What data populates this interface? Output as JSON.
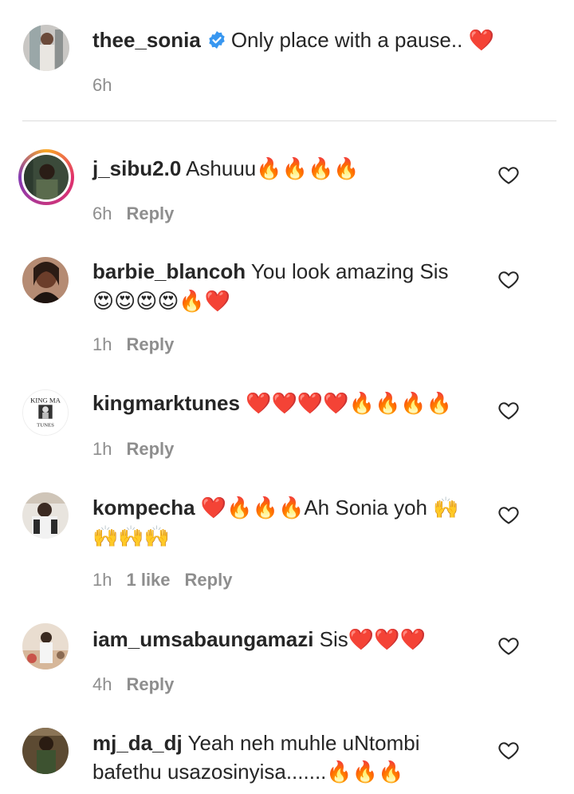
{
  "caption": {
    "username": "thee_sonia",
    "text": "Only place with a pause.. ❤️",
    "time": "6h"
  },
  "comments": [
    {
      "username": "j_sibu2.0",
      "line1": "Ashuuu🔥🔥🔥🔥",
      "line2": "",
      "time": "6h",
      "likes": "",
      "reply": "Reply",
      "has_story_ring": true
    },
    {
      "username": "barbie_blancoh",
      "line1": "You look amazing Sis",
      "line2": "😍😍😍😍🔥❤️",
      "time": "1h",
      "likes": "",
      "reply": "Reply",
      "has_story_ring": false
    },
    {
      "username": "kingmarktunes",
      "line1": "❤️❤️❤️❤️🔥🔥🔥🔥",
      "line2": "",
      "time": "1h",
      "likes": "",
      "reply": "Reply",
      "has_story_ring": false
    },
    {
      "username": "kompecha",
      "line1": "❤️🔥🔥🔥Ah Sonia yoh 🙌",
      "line2": "🙌🙌🙌",
      "time": "1h",
      "likes": "1 like",
      "reply": "Reply",
      "has_story_ring": false
    },
    {
      "username": "iam_umsabaungamazi",
      "line1": "Sis❤️❤️❤️",
      "line2": "",
      "time": "4h",
      "likes": "",
      "reply": "Reply",
      "has_story_ring": false
    },
    {
      "username": "mj_da_dj",
      "line1": "Yeah neh muhle uNtombi",
      "line2": "bafethu usazosinyisa.......🔥🔥🔥",
      "time": "",
      "likes": "",
      "reply": "",
      "has_story_ring": false
    }
  ],
  "avatar_logo_text": {
    "top": "KING MA",
    "bottom": "TUNES"
  },
  "colors": {
    "verified": "#3897f0",
    "secondary_text": "#8e8e8e",
    "divider": "#dbdbdb",
    "heart_outline": "#262626"
  }
}
